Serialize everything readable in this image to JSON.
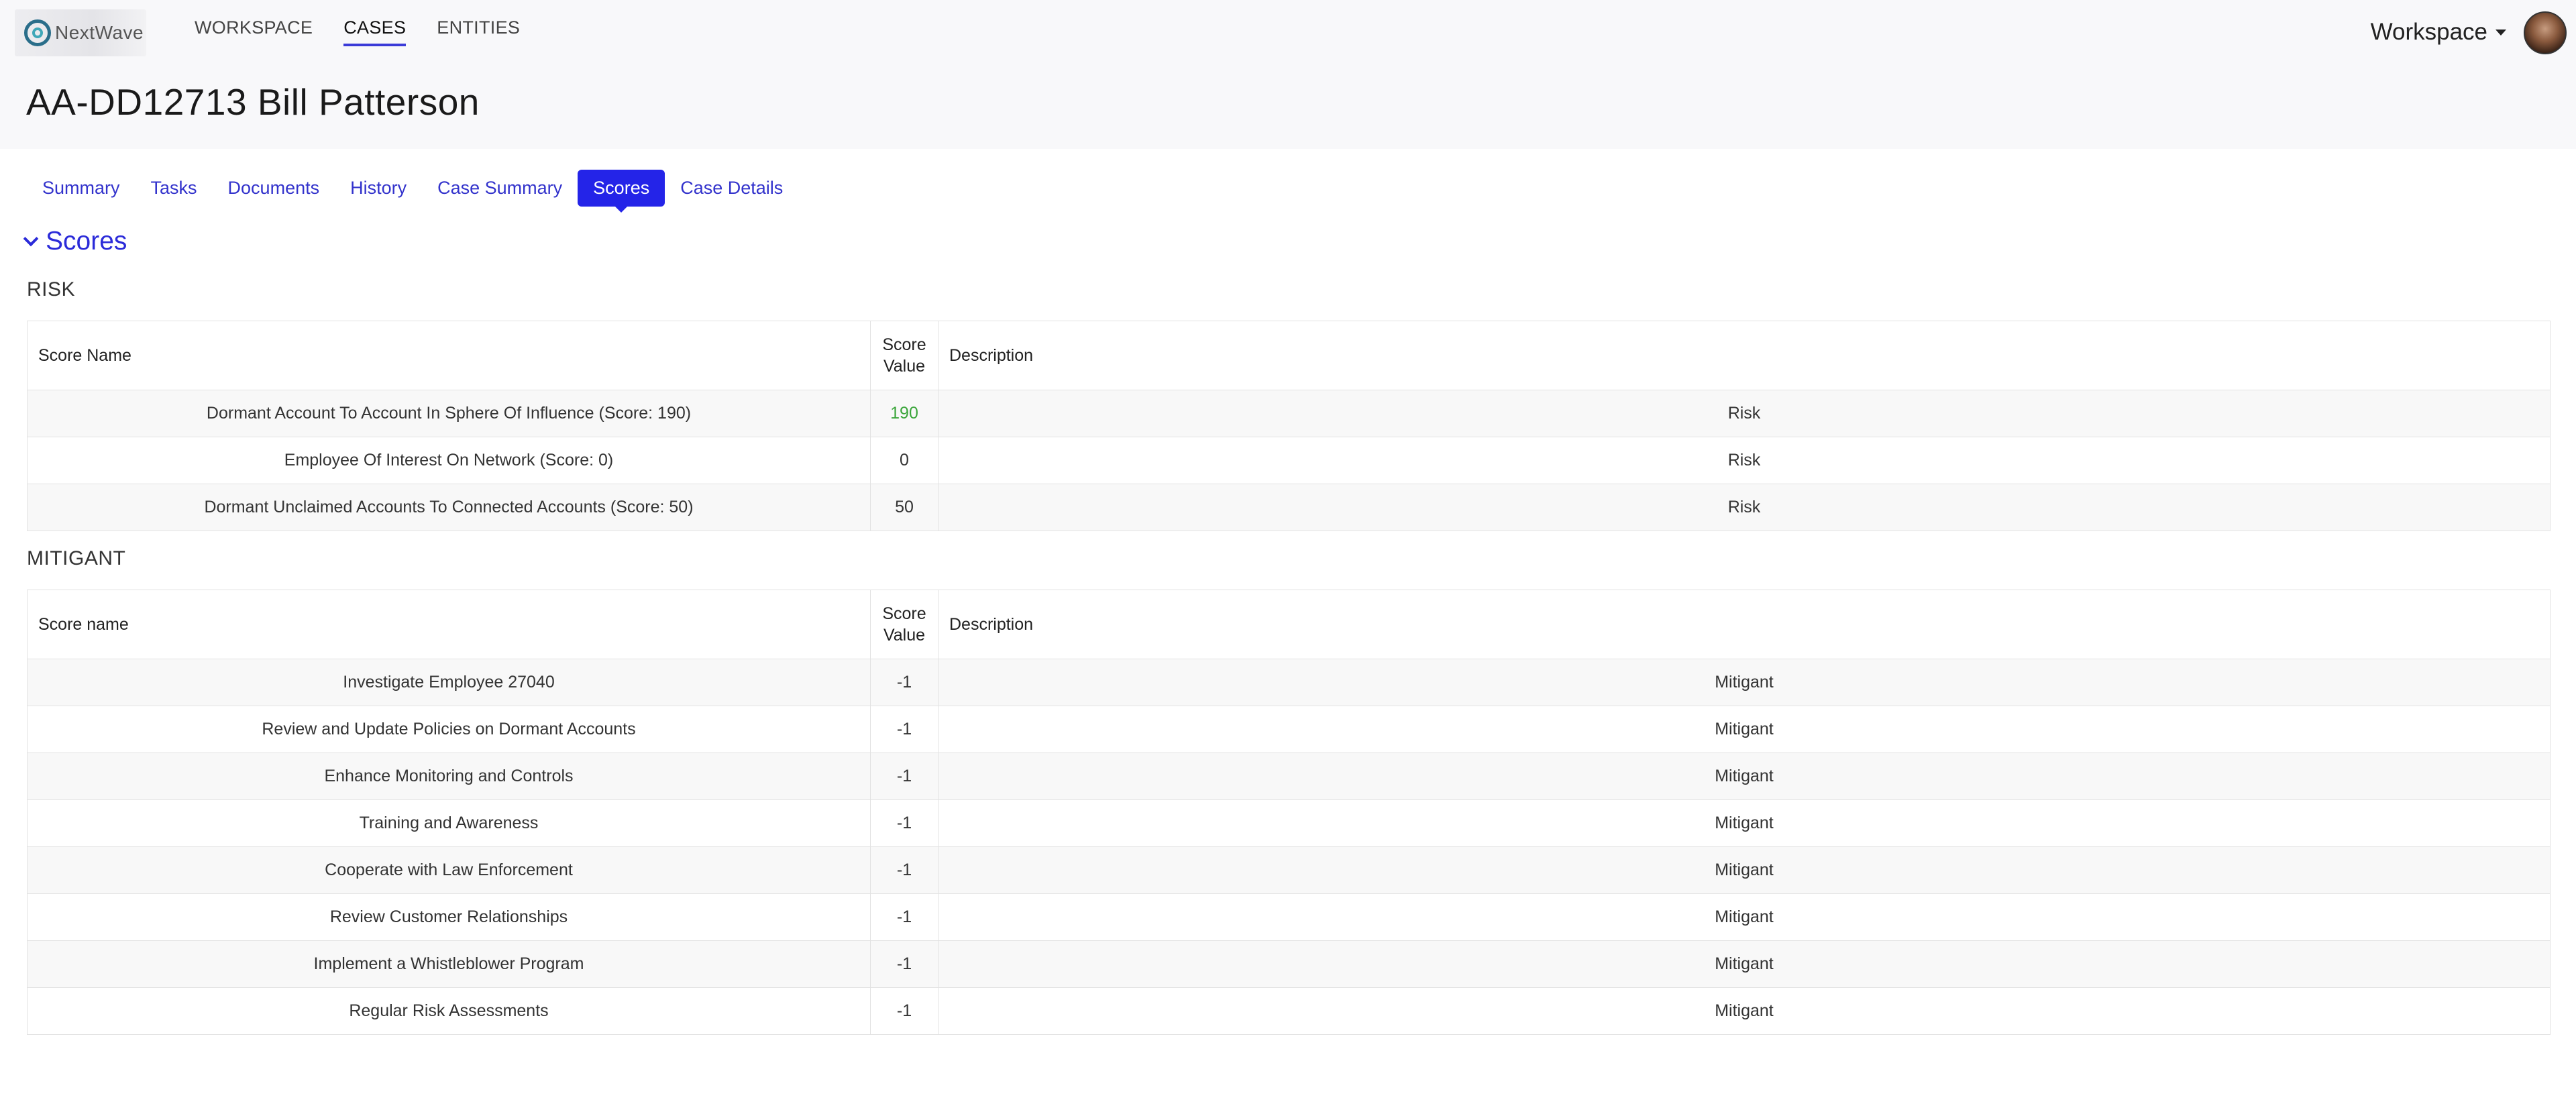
{
  "header": {
    "logo_text": "NextWave",
    "nav": [
      {
        "label": "WORKSPACE",
        "active": false
      },
      {
        "label": "CASES",
        "active": true
      },
      {
        "label": "ENTITIES",
        "active": false
      }
    ],
    "user_menu_label": "Workspace",
    "avatar_icon": "user-avatar"
  },
  "page": {
    "title": "AA-DD12713 Bill Patterson"
  },
  "tabs": [
    {
      "label": "Summary",
      "active": false
    },
    {
      "label": "Tasks",
      "active": false
    },
    {
      "label": "Documents",
      "active": false
    },
    {
      "label": "History",
      "active": false
    },
    {
      "label": "Case Summary",
      "active": false
    },
    {
      "label": "Scores",
      "active": true
    },
    {
      "label": "Case Details",
      "active": false
    }
  ],
  "section": {
    "title": "Scores",
    "icon": "chevron-down-icon"
  },
  "risk": {
    "title": "RISK",
    "columns": [
      "Score Name",
      "Score Value",
      "Description"
    ],
    "rows": [
      {
        "name": "Dormant Account To Account In Sphere Of Influence (Score: 190)",
        "value": "190",
        "description": "Risk"
      },
      {
        "name": "Employee Of Interest On Network (Score: 0)",
        "value": "0",
        "description": "Risk"
      },
      {
        "name": "Dormant Unclaimed Accounts To Connected Accounts (Score: 50)",
        "value": "50",
        "description": "Risk"
      }
    ]
  },
  "mitigant": {
    "title": "MITIGANT",
    "columns": [
      "Score name",
      "Score Value",
      "Description"
    ],
    "rows": [
      {
        "name": "Investigate Employee 27040",
        "value": "-1",
        "description": "Mitigant"
      },
      {
        "name": "Review and Update Policies on Dormant Accounts",
        "value": "-1",
        "description": "Mitigant"
      },
      {
        "name": "Enhance Monitoring and Controls",
        "value": "-1",
        "description": "Mitigant"
      },
      {
        "name": "Training and Awareness",
        "value": "-1",
        "description": "Mitigant"
      },
      {
        "name": "Cooperate with Law Enforcement",
        "value": "-1",
        "description": "Mitigant"
      },
      {
        "name": "Review Customer Relationships",
        "value": "-1",
        "description": "Mitigant"
      },
      {
        "name": "Implement a Whistleblower Program",
        "value": "-1",
        "description": "Mitigant"
      },
      {
        "name": "Regular Risk Assessments",
        "value": "-1",
        "description": "Mitigant"
      }
    ]
  },
  "colors": {
    "accent": "#2424e8",
    "link": "#3333cc",
    "positive_value": "#3aa53a"
  }
}
